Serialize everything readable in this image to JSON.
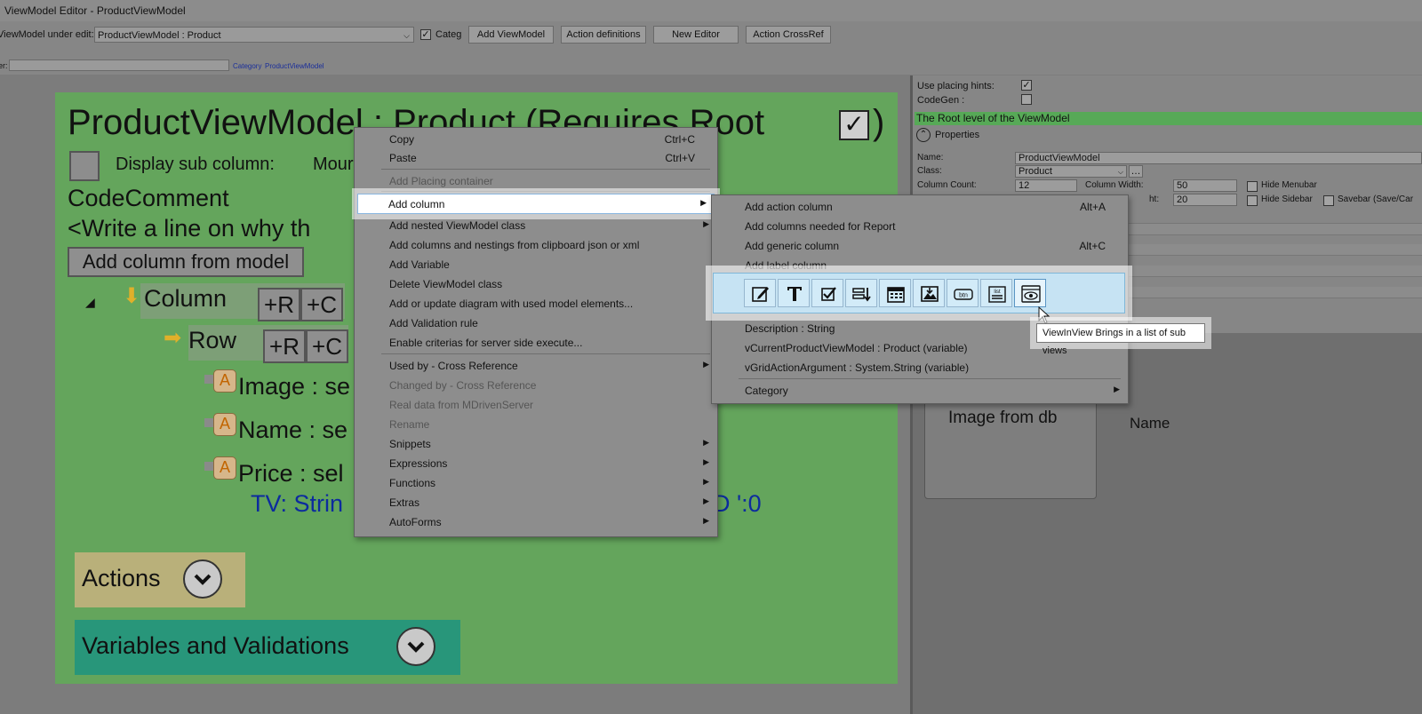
{
  "window": {
    "title": "ViewModel Editor - ProductViewModel"
  },
  "toolbar": {
    "vm_label": "ViewModel under edit:",
    "vm_value": "ProductViewModel : Product",
    "categ_label": "Categ",
    "categ_checked": "✓",
    "add_viewmodel": "Add ViewModel",
    "action_definitions": "Action definitions",
    "new_editor": "New Editor",
    "action_crossref": "Action CrossRef",
    "filter_label": "er:",
    "category_label": "Category",
    "category_value": "ProductViewModel"
  },
  "canvas": {
    "title": "ProductViewModel : Product  (Requires Root",
    "title_check": "✓",
    "title_close": ")",
    "display_sub_columns": "Display sub column:",
    "mount": "Mour",
    "code_comment": "CodeComment",
    "comment_line": "<Write a line on why th",
    "add_column_from_model": "Add column from model",
    "column_label": "Column",
    "row_label": "Row",
    "plus_r": "+R",
    "plus_c": "+C",
    "attr_badge": "A",
    "attrs": [
      "Image : se",
      "Name : se",
      "Price : sel"
    ],
    "tv_line": "TV: Strin",
    "tv_tail": "D  ':0",
    "actions": "Actions",
    "variables": "Variables and Validations"
  },
  "right_panel": {
    "use_placing_hints": "Use placing hints:",
    "use_placing_hints_checked": "✓",
    "codegen": "CodeGen :",
    "root_level": "The Root level of the ViewModel",
    "properties": "Properties",
    "name_label": "Name:",
    "name_value": "ProductViewModel",
    "class_label": "Class:",
    "class_value": "Product",
    "column_count_label": "Column Count:",
    "column_count_value": "12",
    "column_width_label": "Column Width:",
    "column_width_value": "50",
    "height_label": "ht:",
    "height_value": "20",
    "hide_menubar": "Hide Menubar",
    "hide_sidebar": "Hide Sidebar",
    "savebar": "Savebar (Save/Car"
  },
  "preview": {
    "image_from_db": "Image from db",
    "name": "Name"
  },
  "context_menu": {
    "items": [
      {
        "label": "Copy",
        "shortcut": "Ctrl+C"
      },
      {
        "label": "Paste",
        "shortcut": "Ctrl+V"
      },
      {
        "label": "Add Placing container"
      },
      {
        "label": "Add column",
        "arrow": "▶"
      },
      {
        "label": "Add nested ViewModel class",
        "arrow": "▶"
      },
      {
        "label": "Add columns and nestings from clipboard json or xml"
      },
      {
        "label": "Add Variable"
      },
      {
        "label": "Delete ViewModel class"
      },
      {
        "label": "Add or update diagram with used model elements..."
      },
      {
        "label": "Add Validation rule"
      },
      {
        "label": "Enable criterias for server side execute..."
      },
      {
        "label": "Used by - Cross Reference",
        "arrow": "▶"
      },
      {
        "label": "Changed by - Cross Reference"
      },
      {
        "label": "Real data from MDrivenServer"
      },
      {
        "label": "Rename"
      },
      {
        "label": "Snippets",
        "arrow": "▶"
      },
      {
        "label": "Expressions",
        "arrow": "▶"
      },
      {
        "label": "Functions",
        "arrow": "▶"
      },
      {
        "label": "Extras",
        "arrow": "▶"
      },
      {
        "label": "AutoForms",
        "arrow": "▶"
      }
    ]
  },
  "submenu": {
    "items": [
      {
        "label": "Add action column",
        "shortcut": "Alt+A"
      },
      {
        "label": "Add columns needed for Report"
      },
      {
        "label": "Add generic column",
        "shortcut": "Alt+C"
      },
      {
        "label": "Add label column"
      },
      {
        "label": "Description : String"
      },
      {
        "label": "vCurrentProductViewModel : Product (variable)"
      },
      {
        "label": "vGridActionArgument : System.String (variable)"
      },
      {
        "label": "Category",
        "arrow": "▶"
      }
    ],
    "icons": [
      "edit-icon",
      "text-icon",
      "checkbox-icon",
      "combo-icon",
      "calendar-icon",
      "image-icon",
      "button-icon",
      "list-icon",
      "viewinview-icon"
    ],
    "btn_text": "btn",
    "list_text": "list"
  },
  "tooltip": {
    "text": "ViewInView Brings in a list of sub views"
  }
}
